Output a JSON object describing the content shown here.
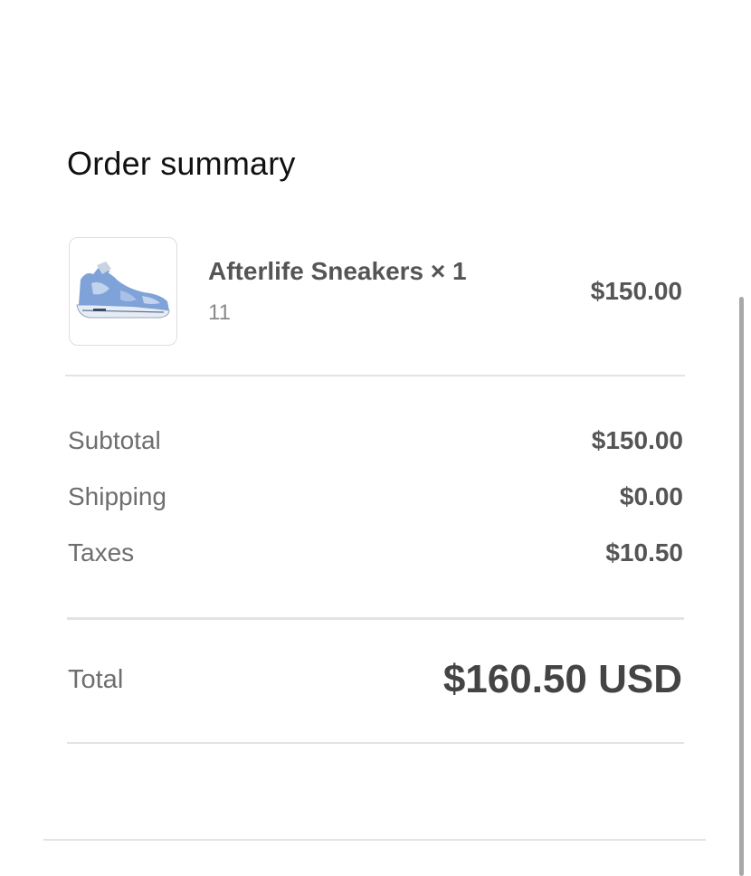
{
  "summary": {
    "heading": "Order summary"
  },
  "product": {
    "name": "Afterlife Sneakers × 1",
    "variant": "11",
    "price": "$150.00",
    "thumbnail_icon": "sneaker-image"
  },
  "totals": {
    "subtotal_label": "Subtotal",
    "subtotal_value": "$150.00",
    "shipping_label": "Shipping",
    "shipping_value": "$0.00",
    "taxes_label": "Taxes",
    "taxes_value": "$10.50",
    "total_label": "Total",
    "total_value": "$160.50 USD"
  },
  "colors": {
    "text_dark": "#111111",
    "text_value": "#555555",
    "text_muted": "#6e6e6e",
    "divider": "#e3e3e3",
    "sneaker_blue": "#7fa3d8"
  }
}
